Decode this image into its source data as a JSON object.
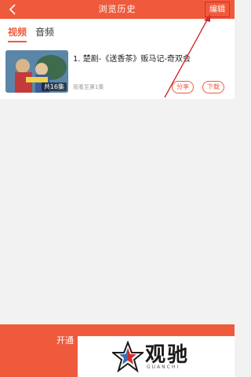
{
  "header": {
    "title": "浏览历史",
    "edit_label": "编辑",
    "back_icon": "back-chevron-icon"
  },
  "tabs": [
    {
      "label": "视频",
      "active": true
    },
    {
      "label": "音频",
      "active": false
    }
  ],
  "history": [
    {
      "title": "1. 楚剧-《送香茶》贩马记-奇双会",
      "episodes_badge": "共16集",
      "progress": "观看至第1集",
      "share_label": "分享",
      "download_label": "下载"
    }
  ],
  "bottom_bar": {
    "label": "开通"
  },
  "watermark": {
    "text": "观驰",
    "sub": "GUANCHI"
  },
  "colors": {
    "accent": "#f05a3c",
    "annotation": "#d42b2b",
    "background": "#f2f2f2"
  }
}
